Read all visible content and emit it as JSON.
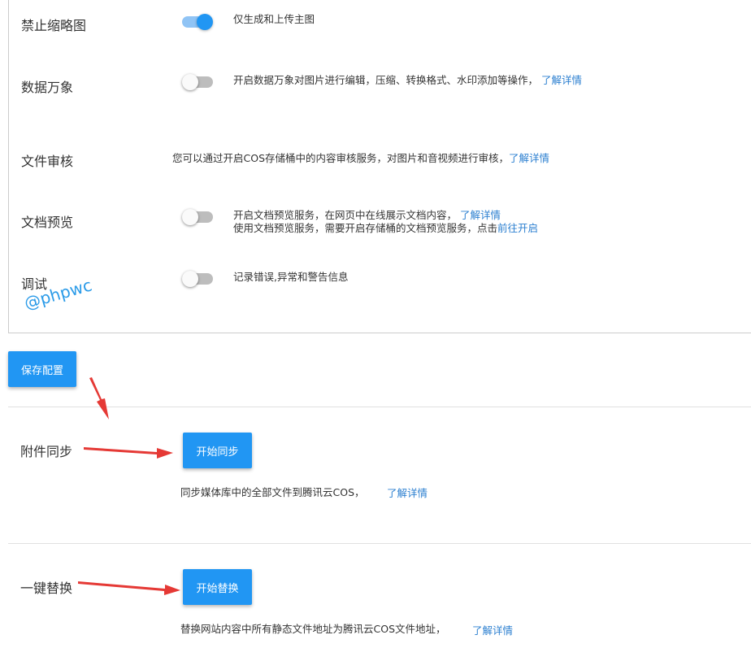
{
  "settings": {
    "thumbnail": {
      "label": "禁止缩略图",
      "desc": "仅生成和上传主图",
      "enabled": true
    },
    "data_wanxiang": {
      "label": "数据万象",
      "desc": "开启数据万象对图片进行编辑，压缩、转换格式、水印添加等操作，",
      "link": "了解详情",
      "enabled": false
    },
    "audit": {
      "label": "文件审核",
      "desc": "您可以通过开启COS存储桶中的内容审核服务，对图片和音视频进行审核，",
      "link": "了解详情"
    },
    "doc_preview": {
      "label": "文档预览",
      "desc1": "开启文档预览服务，在网页中在线展示文档内容，",
      "link1": "了解详情",
      "desc2": "使用文档预览服务，需要开启存储桶的文档预览服务，点击",
      "link2": "前往开启",
      "enabled": false
    },
    "debug": {
      "label": "调试",
      "desc": "记录错误,异常和警告信息",
      "enabled": false
    }
  },
  "watermark": "@phpwc",
  "save_button": "保存配置",
  "sync": {
    "label": "附件同步",
    "button": "开始同步",
    "desc": "同步媒体库中的全部文件到腾讯云COS，",
    "link": "了解详情"
  },
  "replace": {
    "label": "一键替换",
    "button": "开始替换",
    "desc": "替换网站内容中所有静态文件地址为腾讯云COS文件地址，",
    "link": "了解详情"
  },
  "colors": {
    "accent": "#2196f3",
    "link": "#2b7fd0",
    "arrow": "#e53935"
  }
}
